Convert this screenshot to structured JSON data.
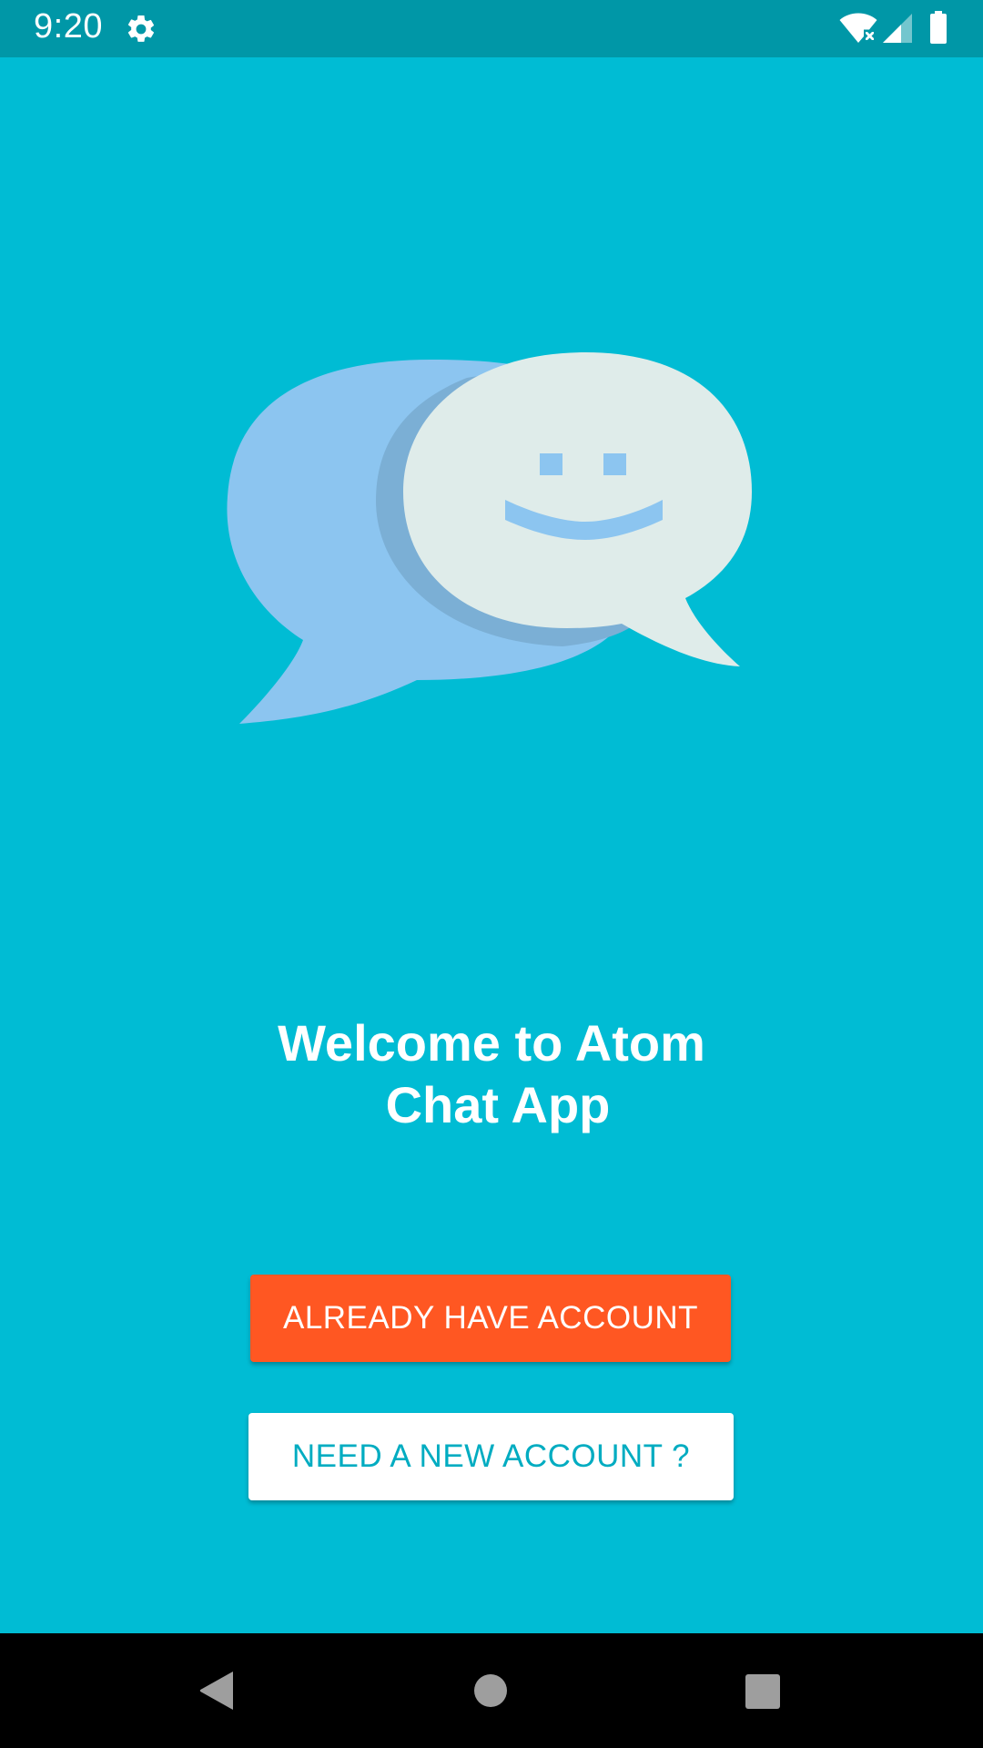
{
  "status_bar": {
    "time": "9:20",
    "icons": [
      "gear-icon",
      "wifi-icon",
      "signal-icon",
      "battery-icon"
    ],
    "background": "#0097A7"
  },
  "logo": {
    "icon": "chat-bubbles-smiley-icon",
    "colors": {
      "back_bubble": "#8CC5F0",
      "front_bubble": "#DFECEA",
      "face": "#8CC5F0"
    }
  },
  "welcome": {
    "line1": "Welcome to Atom",
    "line2": "Chat App"
  },
  "buttons": {
    "login_label": "ALREADY HAVE ACCOUNT",
    "signup_label": "NEED A NEW ACCOUNT ?"
  },
  "colors": {
    "background": "#00BCD4",
    "primary_button": "#FF5722",
    "secondary_text": "#00ACC1"
  },
  "nav_bar": {
    "icons": [
      "back-icon",
      "home-icon",
      "recent-apps-icon"
    ]
  }
}
